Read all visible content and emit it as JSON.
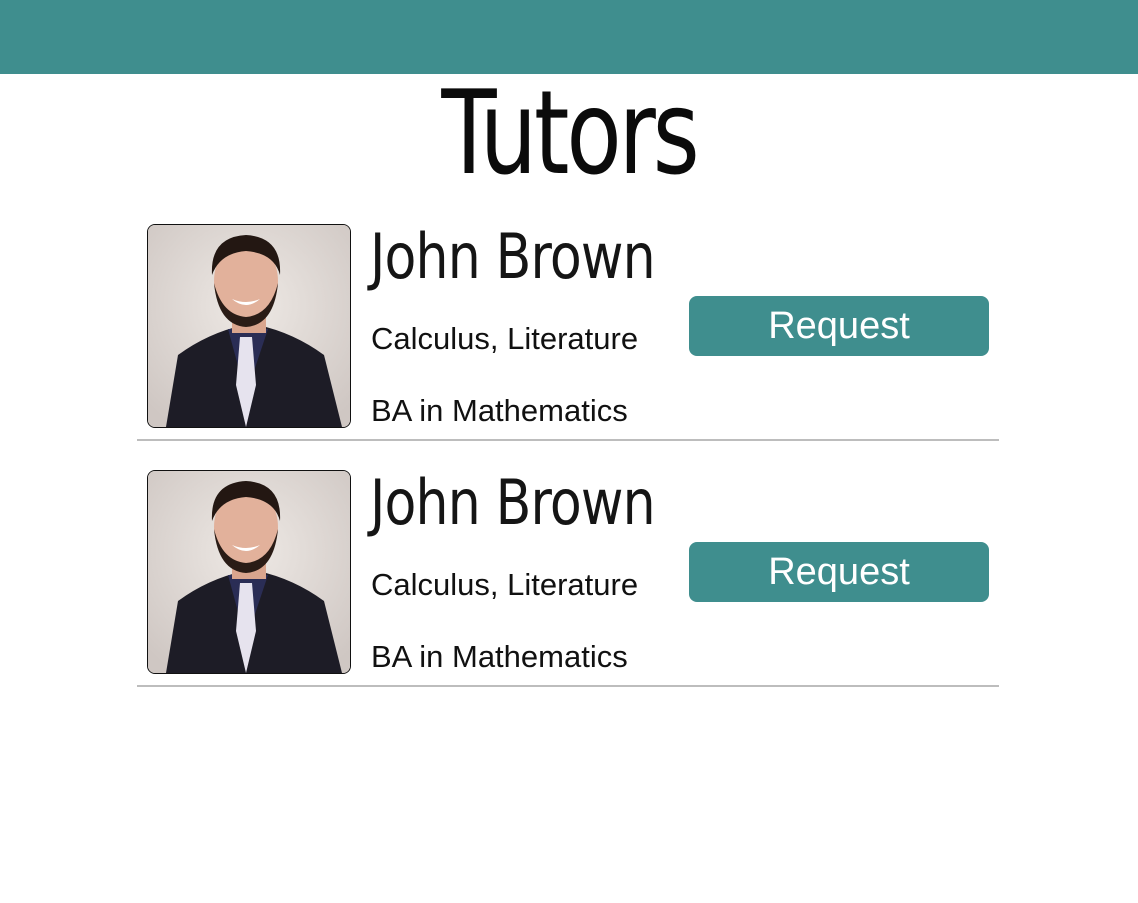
{
  "header": {
    "bar_color": "#3f8e8e"
  },
  "page": {
    "title": "Tutors"
  },
  "tutors": [
    {
      "name": "John Brown",
      "subjects": "Calculus, Literature",
      "degree": "BA in Mathematics",
      "photo_icon": "tutor-photo",
      "request_label": "Request"
    },
    {
      "name": "John Brown",
      "subjects": "Calculus, Literature",
      "degree": "BA in Mathematics",
      "photo_icon": "tutor-photo",
      "request_label": "Request"
    }
  ],
  "colors": {
    "accent": "#3f8e8e",
    "divider": "#bdbdbd",
    "text": "#111111"
  }
}
